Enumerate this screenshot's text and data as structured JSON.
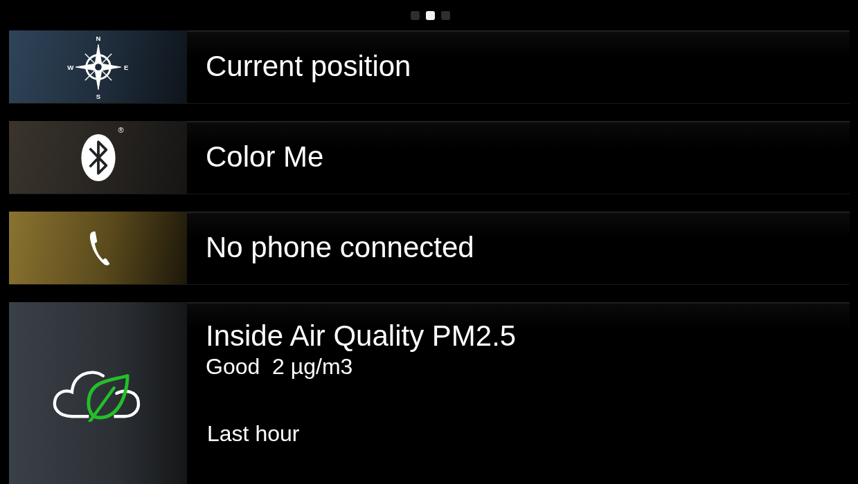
{
  "page_indicator": [
    {
      "selected": false
    },
    {
      "selected": true
    },
    {
      "selected": false
    }
  ],
  "tiles": [
    {
      "kind": "compass",
      "title": "Current position",
      "compass_letters": [
        "N",
        "E",
        "S",
        "W"
      ]
    },
    {
      "kind": "bluetooth",
      "title": "Color Me",
      "mark": "®"
    },
    {
      "kind": "phone",
      "title": "No phone connected"
    },
    {
      "kind": "air",
      "title": "Inside Air Quality PM2.5",
      "reading": "Good  2 µg/m3",
      "period": "Last hour"
    }
  ]
}
